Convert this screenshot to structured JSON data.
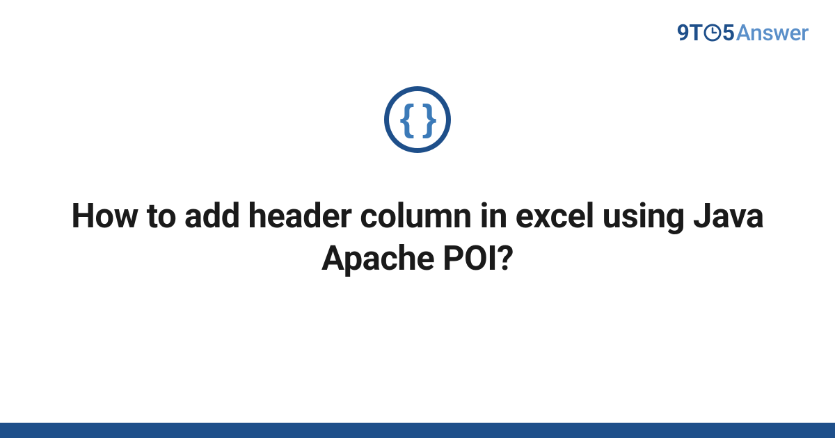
{
  "brand": {
    "nine": "9",
    "t": "T",
    "five": "5",
    "answer": "Answer"
  },
  "badge": {
    "glyph": "{ }"
  },
  "title": "How to add header column in excel using Java Apache POI?",
  "colors": {
    "dark_blue": "#1e4f8a",
    "light_blue": "#5a8fc9",
    "mid_blue": "#3b7ab8"
  }
}
